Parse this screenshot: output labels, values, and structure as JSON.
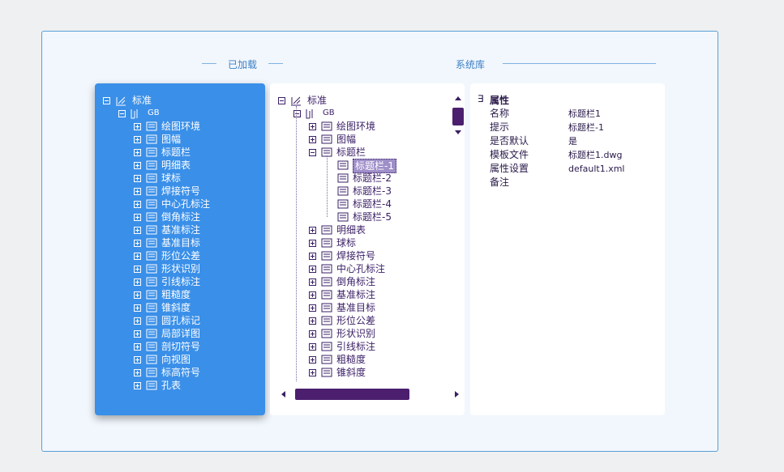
{
  "header": {
    "loaded_label": "已加载",
    "library_label": "系统库"
  },
  "loaded_tree": {
    "root": "标准",
    "gb": "GB",
    "items": [
      "绘图环境",
      "图幅",
      "标题栏",
      "明细表",
      "球标",
      "焊接符号",
      "中心孔标注",
      "倒角标注",
      "基准标注",
      "基准目标",
      "形位公差",
      "形状识别",
      "引线标注",
      "粗糙度",
      "锥斜度",
      "圆孔标记",
      "局部详图",
      "剖切符号",
      "向视图",
      "标高符号",
      "孔表"
    ]
  },
  "library_tree": {
    "root": "标准",
    "gb": "GB",
    "items_before": [
      "绘图环境",
      "图幅"
    ],
    "expanded": "标题栏",
    "children": [
      "标题栏-1",
      "标题栏-2",
      "标题栏-3",
      "标题栏-4",
      "标题栏-5"
    ],
    "selected_child_index": 0,
    "items_after": [
      "明细表",
      "球标",
      "焊接符号",
      "中心孔标注",
      "倒角标注",
      "基准标注",
      "基准目标",
      "形位公差",
      "形状识别",
      "引线标注",
      "粗糙度",
      "锥斜度"
    ]
  },
  "properties": {
    "section_title": "属性",
    "collapse_glyph": "∃",
    "rows": [
      {
        "name": "名称",
        "value": "标题栏1"
      },
      {
        "name": "提示",
        "value": "标题栏-1"
      },
      {
        "name": "是否默认",
        "value": "是"
      },
      {
        "name": "模板文件",
        "value": "标题栏1.dwg"
      },
      {
        "name": "属性设置",
        "value": "default1.xml"
      },
      {
        "name": "备注",
        "value": ""
      }
    ]
  },
  "colors": {
    "loaded_panel": "#3a8fe8",
    "scrollbar": "#4b1f6e",
    "accent_text": "#3d7fc4"
  }
}
